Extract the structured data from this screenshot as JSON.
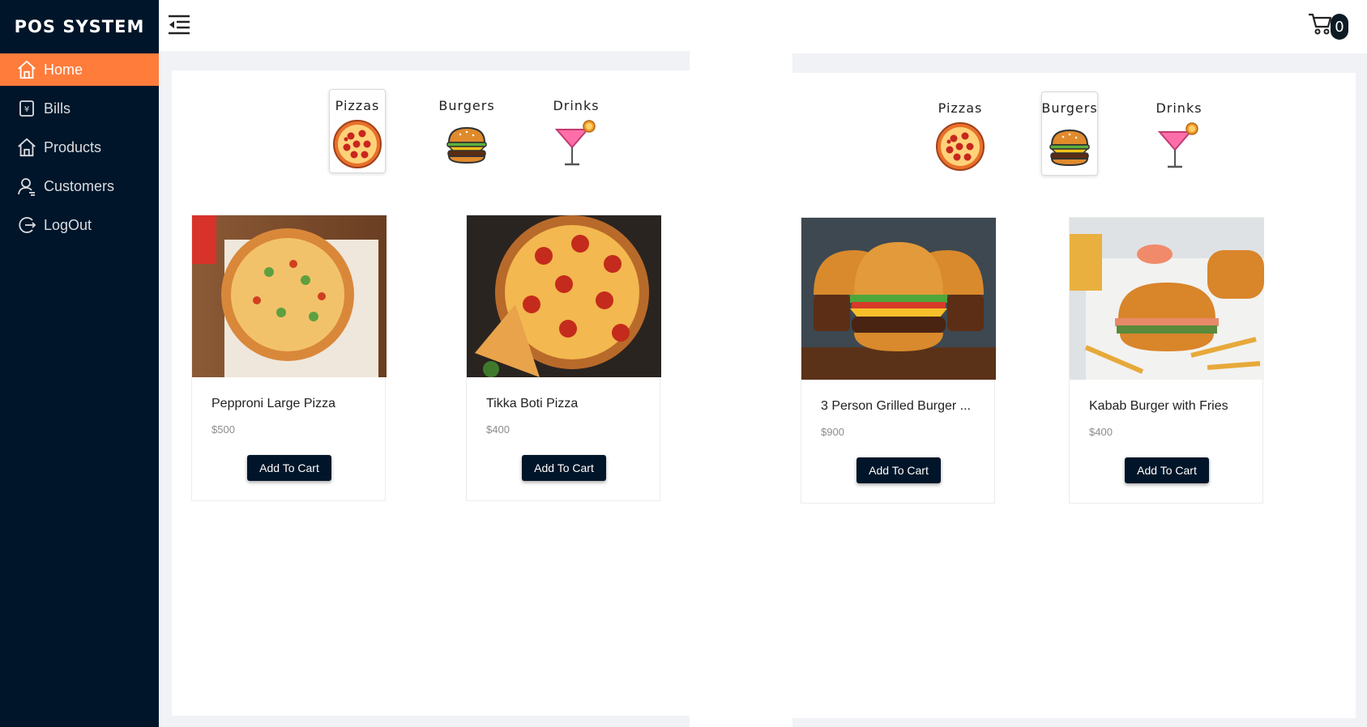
{
  "app": {
    "brand": "POS SYSTEM"
  },
  "sidebar": {
    "items": [
      {
        "label": "Home",
        "icon": "home-icon",
        "active": true
      },
      {
        "label": "Bills",
        "icon": "bill-icon",
        "active": false
      },
      {
        "label": "Products",
        "icon": "home-icon",
        "active": false
      },
      {
        "label": "Customers",
        "icon": "user-icon",
        "active": false
      },
      {
        "label": "LogOut",
        "icon": "logout-icon",
        "active": false
      }
    ]
  },
  "header": {
    "menu_icon": "menu-fold-icon",
    "cart_icon": "cart-icon",
    "cart_count": "0"
  },
  "categories": [
    {
      "label": "Pizzas",
      "icon": "pizza-icon"
    },
    {
      "label": "Burgers",
      "icon": "burger-icon"
    },
    {
      "label": "Drinks",
      "icon": "cocktail-icon"
    }
  ],
  "left_panel": {
    "selected_category": "Pizzas",
    "products": [
      {
        "name": "Pepproni Large Pizza",
        "price": "$500",
        "button": "Add To Cart"
      },
      {
        "name": "Tikka Boti Pizza",
        "price": "$400",
        "button": "Add To Cart"
      }
    ]
  },
  "right_panel": {
    "selected_category": "Burgers",
    "products": [
      {
        "name": "3 Person Grilled Burger ...",
        "price": "$900",
        "button": "Add To Cart"
      },
      {
        "name": "Kabab Burger with Fries",
        "price": "$400",
        "button": "Add To Cart"
      }
    ]
  },
  "colors": {
    "sidebar_bg": "#001529",
    "active_item": "#ff7c3b",
    "button_bg": "#001529",
    "panel_bg": "#f0f2f5"
  }
}
